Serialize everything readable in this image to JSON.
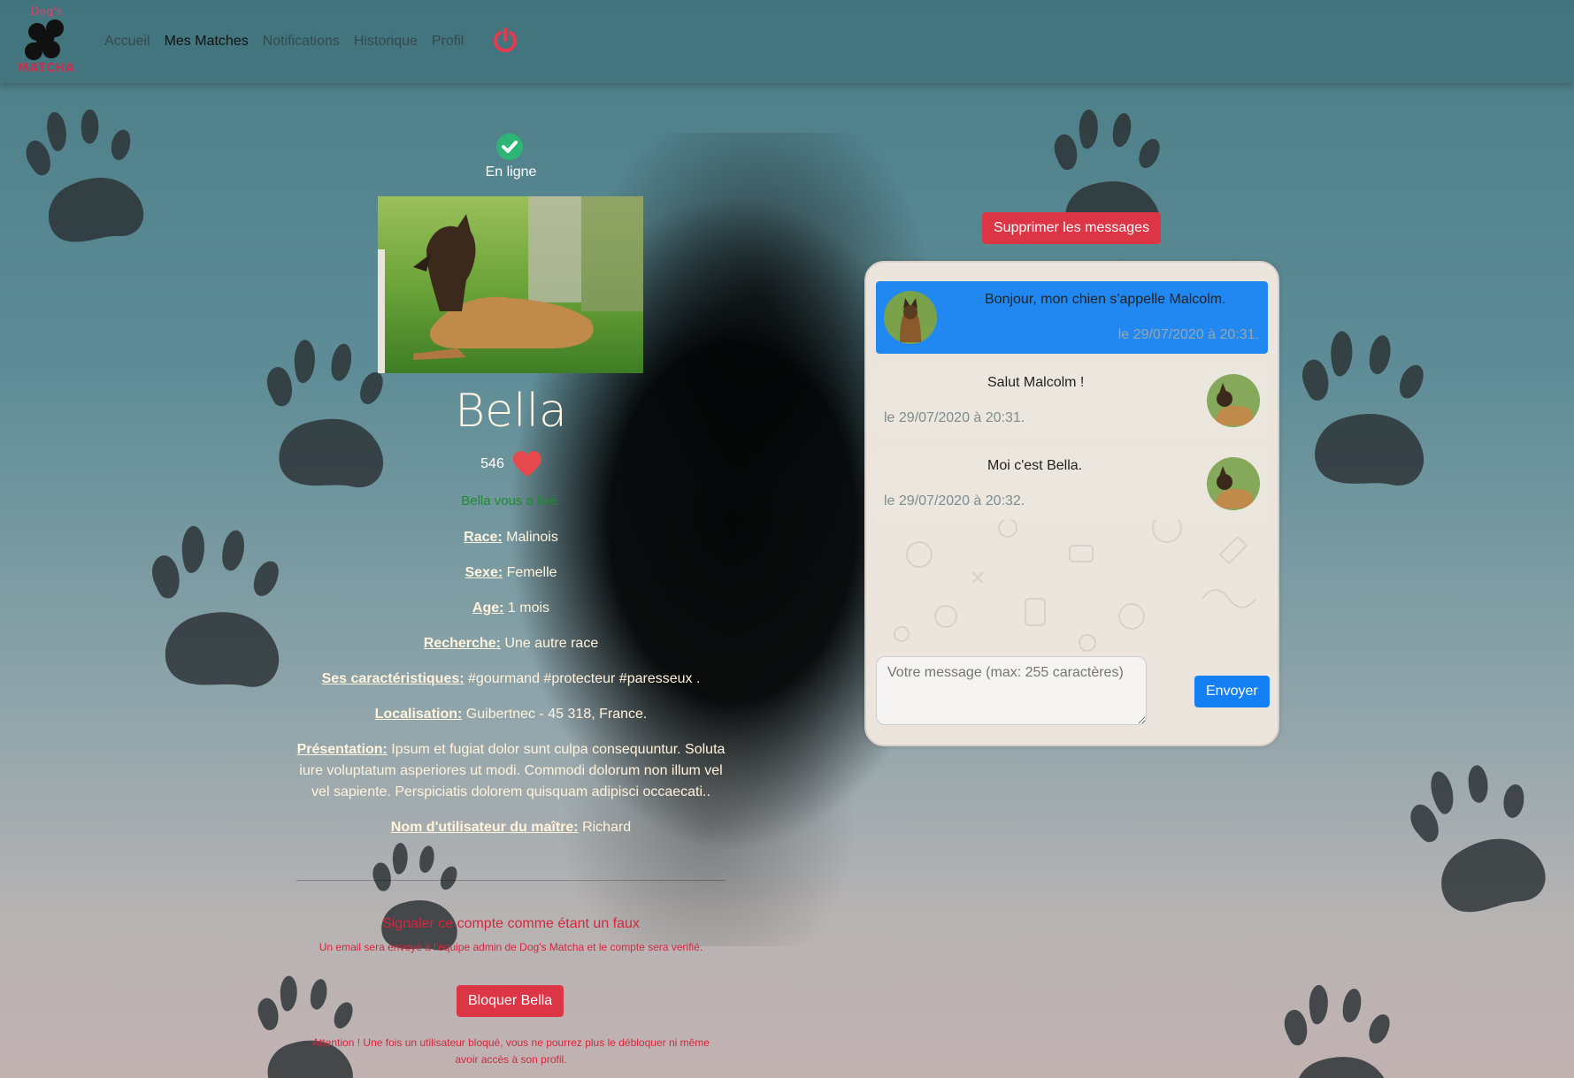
{
  "nav": {
    "logo_top": "Dog's",
    "logo_bottom": "MATCHA",
    "links": [
      "Accueil",
      "Mes Matches",
      "Notifications",
      "Historique",
      "Profil"
    ],
    "active": "Mes Matches",
    "power_icon": "power-icon"
  },
  "profile": {
    "status": "En ligne",
    "name": "Bella",
    "likes": "546",
    "liked_text": "Bella vous a liké.",
    "fields": [
      {
        "key": "Race:",
        "value": " Malinois"
      },
      {
        "key": "Sexe:",
        "value": " Femelle"
      },
      {
        "key": "Age:",
        "value": " 1 mois"
      },
      {
        "key": "Recherche:",
        "value": " Une autre race"
      },
      {
        "key": "Ses caractéristiques:",
        "value": " #gourmand #protecteur #paresseux ."
      },
      {
        "key": "Localisation:",
        "value": " Guibertnec - 45 318, France."
      },
      {
        "key": "Présentation:",
        "value": " Ipsum et fugiat dolor sunt culpa consequuntur. Soluta iure voluptatum asperiores ut modi. Commodi dolorum non illum vel vel sapiente. Perspiciatis dolorem quisquam adipisci occaecati.."
      },
      {
        "key": "Nom d'utilisateur du maître:",
        "value": " Richard"
      }
    ],
    "report_link": "Signaler ce compte comme étant un faux",
    "report_note": "Un email sera envoyé à l'équipe admin de Dog's Matcha et le compte sera verifié.",
    "block_button": "Bloquer Bella",
    "block_note": "Attention ! Une fois un utilisateur bloqué, vous ne pourrez plus le débloquer ni même avoir accès à son profil."
  },
  "chat": {
    "delete_button": "Supprimer les messages",
    "messages": [
      {
        "from": "me",
        "text": "Bonjour, mon chien s'appelle Malcolm.",
        "time": "le 29/07/2020 à 20:31."
      },
      {
        "from": "them",
        "text": "Salut Malcolm !",
        "time": "le 29/07/2020 à 20:31."
      },
      {
        "from": "them",
        "text": "Moi c'est Bella.",
        "time": "le 29/07/2020 à 20:32."
      }
    ],
    "input_placeholder": "Votre message (max: 255 caractères)",
    "send_button": "Envoyer"
  },
  "colors": {
    "danger": "#dc3545",
    "primary": "#1580f4",
    "sent_bubble": "#2088f0",
    "liked_text": "#1c8c2a"
  }
}
